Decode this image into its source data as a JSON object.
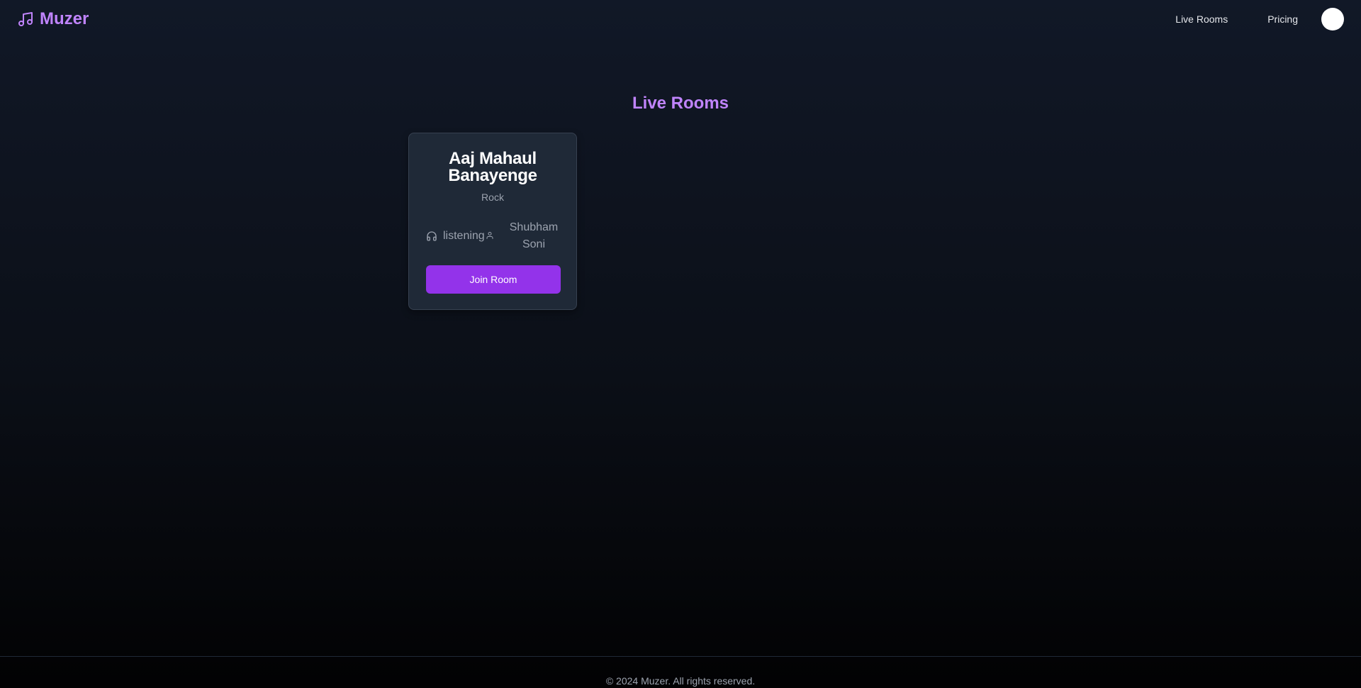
{
  "header": {
    "brand": "Muzer",
    "brand_icon": "music-note-icon",
    "nav": {
      "live_rooms": "Live Rooms",
      "pricing": "Pricing"
    }
  },
  "main": {
    "title": "Live Rooms",
    "rooms": [
      {
        "name": "Aaj Mahaul Banayenge",
        "genre": "Rock",
        "listeners_label": "listening",
        "listeners_icon": "headphones-icon",
        "host": "Shubham Soni",
        "host_icon": "user-icon",
        "join_label": "Join Room"
      }
    ]
  },
  "footer": {
    "copyright": "© 2024 Muzer. All rights reserved."
  },
  "colors": {
    "accent": "#c084fc",
    "button": "#9333ea",
    "card": "#1f2937",
    "muted_text": "#9ca3af"
  }
}
